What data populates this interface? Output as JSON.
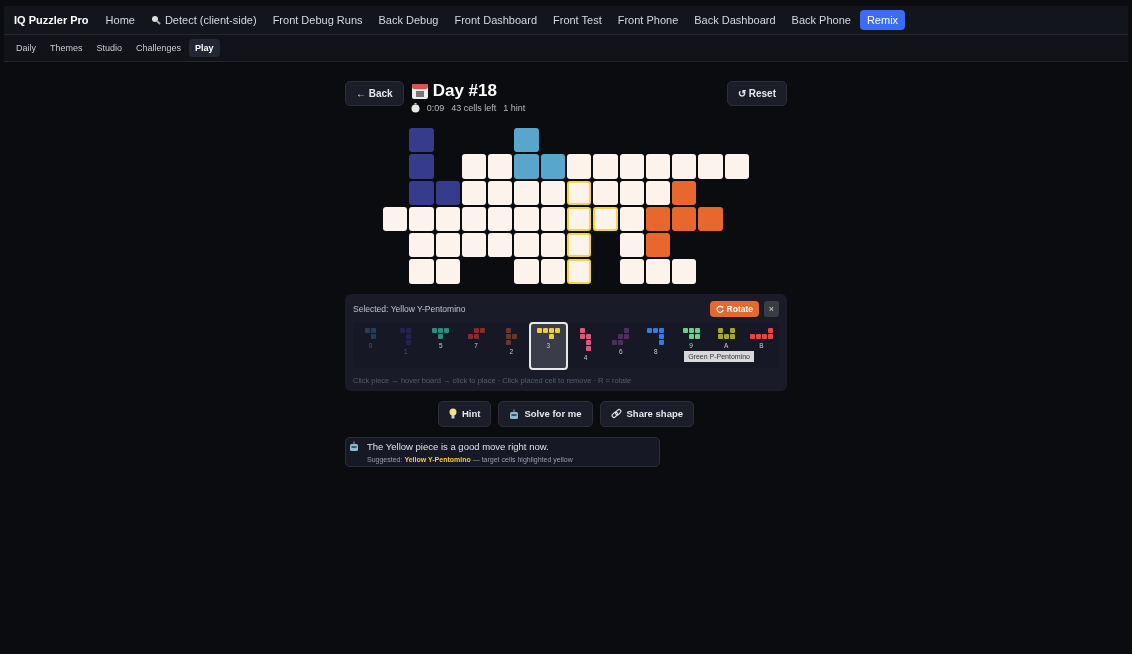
{
  "nav": {
    "brand": "IQ Puzzler Pro",
    "items": [
      {
        "label": "Home",
        "kind": "plain",
        "selected": false
      },
      {
        "label": "Detect (client-side)",
        "kind": "search",
        "selected": false
      },
      {
        "label": "Front Debug Runs",
        "kind": "plain",
        "selected": false
      },
      {
        "label": "Back Debug",
        "kind": "plain",
        "selected": false
      },
      {
        "label": "Front Dashboard",
        "kind": "plain",
        "selected": false
      },
      {
        "label": "Front Test",
        "kind": "plain",
        "selected": false
      },
      {
        "label": "Front Phone",
        "kind": "plain",
        "selected": false
      },
      {
        "label": "Back Dashboard",
        "kind": "plain",
        "selected": false
      },
      {
        "label": "Back Phone",
        "kind": "plain",
        "selected": false
      },
      {
        "label": "Remix",
        "kind": "plain",
        "selected": true
      }
    ]
  },
  "subnav": [
    {
      "label": "Daily",
      "selected": false
    },
    {
      "label": "Themes",
      "selected": false
    },
    {
      "label": "Studio",
      "selected": false
    },
    {
      "label": "Challenges",
      "selected": false
    },
    {
      "label": "Play",
      "selected": true
    }
  ],
  "header": {
    "back": "← Back",
    "title": "Day #18",
    "timer": "0:09",
    "cells_left": "43 cells left",
    "hints": "1 hint",
    "reset": "↺ Reset"
  },
  "board": {
    "rows": [
      {
        "cells": [
          {
            "kind": "none"
          },
          {
            "kind": "piece",
            "color": "#363b8c"
          },
          {
            "kind": "none"
          },
          {
            "kind": "none"
          },
          {
            "kind": "none"
          },
          {
            "kind": "piece",
            "color": "#58a6cc"
          },
          {
            "kind": "none"
          },
          {
            "kind": "none"
          },
          {
            "kind": "none"
          },
          {
            "kind": "none"
          },
          {
            "kind": "none"
          },
          {
            "kind": "none"
          },
          {
            "kind": "none"
          },
          {
            "kind": "none"
          }
        ]
      },
      {
        "cells": [
          {
            "kind": "none"
          },
          {
            "kind": "piece",
            "color": "#363b8c"
          },
          {
            "kind": "none"
          },
          {
            "kind": "empty"
          },
          {
            "kind": "empty"
          },
          {
            "kind": "piece",
            "color": "#58a6cc"
          },
          {
            "kind": "piece",
            "color": "#58a6cc"
          },
          {
            "kind": "empty"
          },
          {
            "kind": "empty"
          },
          {
            "kind": "empty"
          },
          {
            "kind": "empty"
          },
          {
            "kind": "empty"
          },
          {
            "kind": "empty"
          },
          {
            "kind": "empty"
          }
        ]
      },
      {
        "cells": [
          {
            "kind": "none"
          },
          {
            "kind": "piece",
            "color": "#363b8c"
          },
          {
            "kind": "piece",
            "color": "#363b8c"
          },
          {
            "kind": "empty"
          },
          {
            "kind": "empty"
          },
          {
            "kind": "empty"
          },
          {
            "kind": "empty"
          },
          {
            "kind": "hint"
          },
          {
            "kind": "empty"
          },
          {
            "kind": "empty"
          },
          {
            "kind": "empty"
          },
          {
            "kind": "piece",
            "color": "#e8672c"
          },
          {
            "kind": "none"
          },
          {
            "kind": "none"
          }
        ]
      },
      {
        "cells": [
          {
            "kind": "empty"
          },
          {
            "kind": "empty"
          },
          {
            "kind": "empty"
          },
          {
            "kind": "empty"
          },
          {
            "kind": "empty"
          },
          {
            "kind": "empty"
          },
          {
            "kind": "empty"
          },
          {
            "kind": "hint"
          },
          {
            "kind": "hint"
          },
          {
            "kind": "empty"
          },
          {
            "kind": "piece",
            "color": "#e8672c"
          },
          {
            "kind": "piece",
            "color": "#e8672c"
          },
          {
            "kind": "piece",
            "color": "#e8672c"
          },
          {
            "kind": "none"
          }
        ]
      },
      {
        "cells": [
          {
            "kind": "none"
          },
          {
            "kind": "empty"
          },
          {
            "kind": "empty"
          },
          {
            "kind": "empty"
          },
          {
            "kind": "empty"
          },
          {
            "kind": "empty"
          },
          {
            "kind": "empty"
          },
          {
            "kind": "hint"
          },
          {
            "kind": "none"
          },
          {
            "kind": "empty"
          },
          {
            "kind": "piece",
            "color": "#e8672c"
          },
          {
            "kind": "none"
          },
          {
            "kind": "none"
          },
          {
            "kind": "none"
          }
        ]
      },
      {
        "cells": [
          {
            "kind": "none"
          },
          {
            "kind": "empty"
          },
          {
            "kind": "empty"
          },
          {
            "kind": "none"
          },
          {
            "kind": "none"
          },
          {
            "kind": "empty"
          },
          {
            "kind": "empty"
          },
          {
            "kind": "hint"
          },
          {
            "kind": "none"
          },
          {
            "kind": "empty"
          },
          {
            "kind": "empty"
          },
          {
            "kind": "empty"
          },
          {
            "kind": "none"
          },
          {
            "kind": "none"
          }
        ]
      }
    ]
  },
  "tray": {
    "selected_label": "Selected: Yellow Y-Pentomino",
    "rotate": "Rotate",
    "close": "×",
    "pieces": [
      {
        "label": "0",
        "color": "#243f55",
        "shape": [
          [
            true,
            true
          ],
          [
            false,
            true
          ]
        ],
        "placed": true,
        "selected": false
      },
      {
        "label": "1",
        "color": "#22244f",
        "shape": [
          [
            true,
            true
          ],
          [
            false,
            true
          ],
          [
            false,
            true
          ]
        ],
        "placed": true,
        "selected": false
      },
      {
        "label": "5",
        "color": "#2e8a7a",
        "shape": [
          [
            true,
            true,
            true
          ],
          [
            false,
            true,
            false
          ]
        ],
        "placed": false,
        "selected": false
      },
      {
        "label": "7",
        "color": "#8a2a2a",
        "shape": [
          [
            false,
            true,
            true
          ],
          [
            true,
            true,
            false
          ]
        ],
        "placed": false,
        "selected": false
      },
      {
        "label": "2",
        "color": "#6e3626",
        "shape": [
          [
            true,
            false
          ],
          [
            true,
            true
          ],
          [
            true,
            false
          ]
        ],
        "placed": false,
        "selected": false
      },
      {
        "label": "3",
        "color": "#f2cd3a",
        "shape": [
          [
            true,
            true,
            true,
            true
          ],
          [
            false,
            false,
            true,
            false
          ]
        ],
        "placed": false,
        "selected": true
      },
      {
        "label": "4",
        "color": "#dc5a78",
        "shape": [
          [
            true,
            false
          ],
          [
            true,
            true
          ],
          [
            false,
            true
          ],
          [
            false,
            true
          ]
        ],
        "placed": false,
        "selected": false
      },
      {
        "label": "6",
        "color": "#4e2e5e",
        "shape": [
          [
            false,
            false,
            true
          ],
          [
            false,
            true,
            true
          ],
          [
            true,
            true,
            false
          ]
        ],
        "placed": false,
        "selected": false
      },
      {
        "label": "8",
        "color": "#2f7de0",
        "shape": [
          [
            true,
            true,
            true
          ],
          [
            false,
            false,
            true
          ],
          [
            false,
            false,
            true
          ]
        ],
        "placed": false,
        "selected": false
      },
      {
        "label": "9",
        "color": "#6fcf86",
        "shape": [
          [
            true,
            true,
            true
          ],
          [
            false,
            true,
            true
          ]
        ],
        "placed": false,
        "selected": false
      },
      {
        "label": "A",
        "color": "#a6a62c",
        "shape": [
          [
            true,
            false,
            true
          ],
          [
            true,
            true,
            true
          ]
        ],
        "placed": false,
        "selected": false
      },
      {
        "label": "B",
        "color": "#e8473e",
        "shape": [
          [
            false,
            false,
            false,
            true
          ],
          [
            true,
            true,
            true,
            true
          ]
        ],
        "placed": false,
        "selected": false
      }
    ],
    "tooltip": "Green P-Pentomino",
    "help": "Click piece → hover board → click to place · Click placed cell to remove · R = rotate"
  },
  "actions": [
    {
      "label": "Hint",
      "kind": "hint"
    },
    {
      "label": "Solve for me",
      "kind": "solve"
    },
    {
      "label": "Share shape",
      "kind": "share"
    }
  ],
  "message": {
    "text": "The Yellow piece is a good move right now.",
    "detail": "Suggested: **Yellow Y-Pentomino** — target cells highlighted yellow"
  }
}
